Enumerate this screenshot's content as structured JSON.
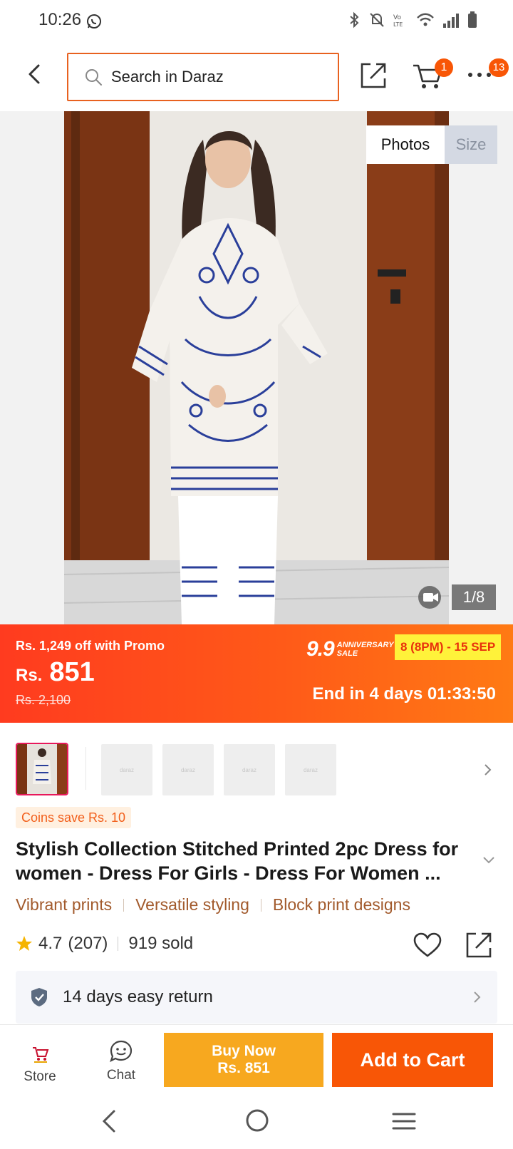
{
  "status_bar": {
    "time": "10:26"
  },
  "top_nav": {
    "search_placeholder": "Search in Daraz",
    "cart_count": "1",
    "more_count": "13"
  },
  "gallery": {
    "tab_photos": "Photos",
    "tab_size": "Size",
    "counter": "1/8"
  },
  "promo": {
    "off_text": "Rs. 1,249 off with Promo",
    "currency": "Rs.",
    "price": "851",
    "old_price": "Rs. 2,100",
    "campaign_big": "9.9",
    "campaign_small_1": "ANNIVERSARY",
    "campaign_small_2": "SALE",
    "campaign_dates": "8 (8PM) - 15 SEP",
    "timer": "End in 4 days 01:33:50"
  },
  "thumbnails": {
    "placeholder_label": "daraz"
  },
  "product": {
    "coins": "Coins save Rs. 10",
    "title": "Stylish Collection Stitched Printed 2pc Dress for women - Dress For Girls - Dress For Women ...",
    "features": [
      "Vibrant prints",
      "Versatile styling",
      "Block print designs"
    ],
    "rating": "4.7",
    "reviews": "(207)",
    "sold": "919 sold",
    "return_policy": "14 days easy return"
  },
  "actions": {
    "store_label": "Store",
    "chat_label": "Chat",
    "buy_now_line1": "Buy Now",
    "buy_now_line2": "Rs. 851",
    "add_to_cart": "Add to Cart"
  },
  "colors": {
    "brand": "#f85606",
    "buy_now": "#f7a81f",
    "feature_text": "#a25a2c",
    "coin_text": "#f25f1b"
  }
}
